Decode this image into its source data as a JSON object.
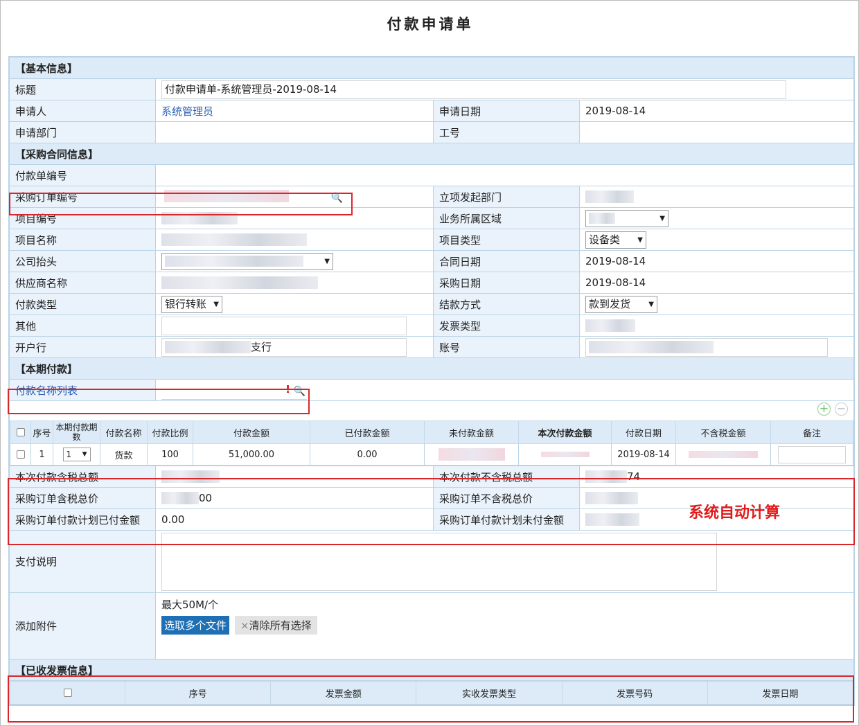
{
  "page_title": "付款申请单",
  "sections": {
    "basic": "【基本信息】",
    "contract": "【采购合同信息】",
    "payment": "【本期付款】",
    "invoice": "【已收发票信息】"
  },
  "basic": {
    "title_label": "标题",
    "title_value": "付款申请单-系统管理员-2019-08-14",
    "applicant_label": "申请人",
    "applicant_value": "系统管理员",
    "apply_date_label": "申请日期",
    "apply_date_value": "2019-08-14",
    "dept_label": "申请部门",
    "work_no_label": "工号"
  },
  "contract": {
    "pay_no_label": "付款单编号",
    "po_no_label": "采购订单编号",
    "origin_dept_label": "立项发起部门",
    "project_no_label": "项目编号",
    "region_label": "业务所属区域",
    "project_name_label": "项目名称",
    "project_type_label": "项目类型",
    "project_type_value": "设备类",
    "company_label": "公司抬头",
    "contract_date_label": "合同日期",
    "contract_date_value": "2019-08-14",
    "supplier_label": "供应商名称",
    "purchase_date_label": "采购日期",
    "purchase_date_value": "2019-08-14",
    "pay_type_label": "付款类型",
    "pay_type_value": "银行转账",
    "settle_label": "结款方式",
    "settle_value": "款到发货",
    "other_label": "其他",
    "invoice_type_label": "发票类型",
    "bank_label": "开户行",
    "bank_suffix": "支行",
    "account_label": "账号"
  },
  "payment": {
    "list_label": "付款名称列表",
    "required_mark": "!",
    "columns": [
      "序号",
      "本期付款期数",
      "付款名称",
      "付款比例",
      "付款金额",
      "已付款金额",
      "未付款金额",
      "本次付款金额",
      "付款日期",
      "不含税金额",
      "备注"
    ],
    "row": {
      "index": "1",
      "period": "1",
      "name": "货款",
      "ratio": "100",
      "amount": "51,000.00",
      "paid": "0.00",
      "date": "2019-08-14"
    },
    "tax_total_label": "本次付款含税总额",
    "notax_total_label": "本次付款不含税总额",
    "notax_total_tail": "74",
    "po_tax_label": "采购订单含税总价",
    "po_tax_tail": "00",
    "po_notax_label": "采购订单不含税总价",
    "plan_paid_label": "采购订单付款计划已付金额",
    "plan_paid_value": "0.00",
    "plan_unpaid_label": "采购订单付款计划未付金额",
    "note": "系统自动计算",
    "desc_label": "支付说明",
    "attach_label": "添加附件",
    "attach_limit": "最大50M/个",
    "choose_btn": "选取多个文件",
    "clear_btn": "清除所有选择"
  },
  "invoice": {
    "columns": [
      "序号",
      "发票金额",
      "实收发票类型",
      "发票号码",
      "发票日期"
    ]
  },
  "colors": {
    "section_bg": "#dcebf7",
    "border": "#b9d3e6",
    "highlight": "#d9262b",
    "link": "#2a5eb0"
  }
}
